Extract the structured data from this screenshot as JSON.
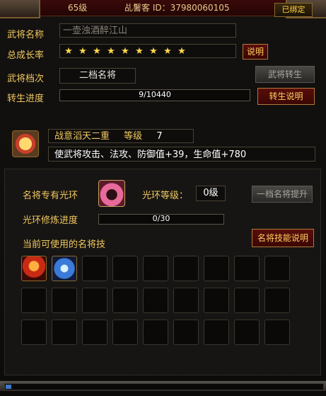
{
  "header": {
    "level": "65级",
    "nick": "乩鬐客 ID：37980060105",
    "bound": "已绑定"
  },
  "general": {
    "name_label": "武将名称",
    "name_value": "一壶浊酒醉江山",
    "growth_label": "总成长率",
    "growth_stars": 9,
    "growth_help": "说明",
    "rank_label": "武将档次",
    "rank_value": "二档名将",
    "reborn_button": "武将转生",
    "reborn_label": "转生进度",
    "reborn_progress": "9/10440",
    "reborn_help": "转生说明",
    "reborn_fraction": 0.00086
  },
  "skill": {
    "name": "战意滔天二重",
    "level_label": "等级",
    "level_value": "7",
    "desc": "使武将攻击、法攻、防御值+39，生命值+780"
  },
  "aura": {
    "label": "名将专有光环",
    "level_label": "光环等级：",
    "level_value": "0级",
    "upgrade_button": "一档名将提升",
    "refine_label": "光环修炼进度",
    "refine_progress": "0/30",
    "refine_fraction": 0
  },
  "skills_section": {
    "label": "当前可使用的名将技",
    "help_button": "名将技能说明"
  },
  "colors": {
    "gold": "#f0c860",
    "accent_red": "#5a0e0a",
    "progress_blue": "#2a5a98"
  }
}
